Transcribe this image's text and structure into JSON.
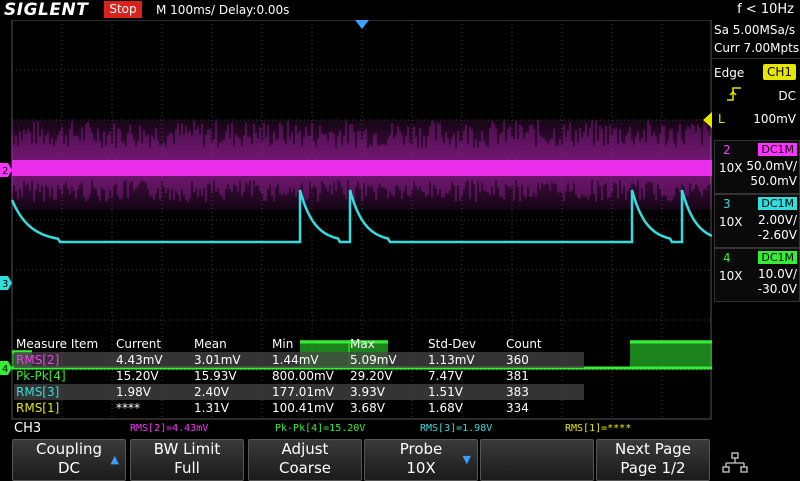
{
  "header": {
    "logo": "SIGLENT",
    "run_state": "Stop",
    "timebase": "M 100ms/  Delay:0.00s",
    "frequency": "f < 10Hz"
  },
  "acquisition": {
    "sample_rate": "Sa 5.00MSa/s",
    "memory": "Curr 7.00Mpts"
  },
  "trigger": {
    "type": "Edge",
    "source": "CH1",
    "slope_icon": "rising-edge-icon",
    "coupling": "DC",
    "level": "100mV",
    "level_marker": "L"
  },
  "channels": [
    {
      "num": "2",
      "coupling": "DC1M",
      "probe": "10X",
      "scale": "50.0mV/",
      "offset": "50.0mV",
      "color": "#ff33ff"
    },
    {
      "num": "3",
      "coupling": "DC1M",
      "probe": "10X",
      "scale": "2.00V/",
      "offset": "-2.60V",
      "color": "#33dddd"
    },
    {
      "num": "4",
      "coupling": "DC1M",
      "probe": "10X",
      "scale": "10.0V/",
      "offset": "-30.0V",
      "color": "#33ee33"
    }
  ],
  "channel_markers": {
    "ch2": "2",
    "ch3": "3",
    "ch4": "4"
  },
  "measure_table": {
    "headers": [
      "Measure Item",
      "Current",
      "Mean",
      "Min",
      "Max",
      "Std-Dev",
      "Count"
    ],
    "rows": [
      {
        "item": "RMS[2]",
        "current": "4.43mV",
        "mean": "3.01mV",
        "min": "1.44mV",
        "max": "5.09mV",
        "std": "1.13mV",
        "count": "360",
        "color": "#ff33ff"
      },
      {
        "item": "Pk-Pk[4]",
        "current": "15.20V",
        "mean": "15.93V",
        "min": "800.00mV",
        "max": "29.20V",
        "std": "7.47V",
        "count": "381",
        "color": "#33ee33"
      },
      {
        "item": "RMS[3]",
        "current": "1.98V",
        "mean": "2.40V",
        "min": "177.01mV",
        "max": "3.93V",
        "std": "1.51V",
        "count": "383",
        "color": "#33dddd"
      },
      {
        "item": "RMS[1]",
        "current": "****",
        "mean": "1.31V",
        "min": "100.41mV",
        "max": "3.68V",
        "std": "1.68V",
        "count": "334",
        "color": "#e6e600"
      }
    ]
  },
  "active_channel": "CH3",
  "info_line": [
    {
      "text": "RMS[2]=4.43mV",
      "color": "#ff33ff"
    },
    {
      "text": "Pk-Pk[4]=15.20V",
      "color": "#33ee33"
    },
    {
      "text": "RMS[3]=1.98V",
      "color": "#33dddd"
    },
    {
      "text": "RMS[1]=****",
      "color": "#e6e600"
    }
  ],
  "softkeys": [
    {
      "line1": "Coupling",
      "line2": "DC",
      "arrow": "up-arrow-icon"
    },
    {
      "line1": "BW Limit",
      "line2": "Full"
    },
    {
      "line1": "Adjust",
      "line2": "Coarse"
    },
    {
      "line1": "Probe",
      "line2": "10X",
      "arrow": "down-arrow-icon"
    },
    {
      "line1": "",
      "line2": ""
    },
    {
      "line1": "Next Page",
      "line2": "Page 1/2"
    }
  ],
  "colors": {
    "ch1": "#e6e600",
    "ch2": "#ff33ff",
    "ch3": "#33dddd",
    "ch4": "#33ee33",
    "stop": "#d8231d",
    "accent": "#3aa0ff"
  }
}
